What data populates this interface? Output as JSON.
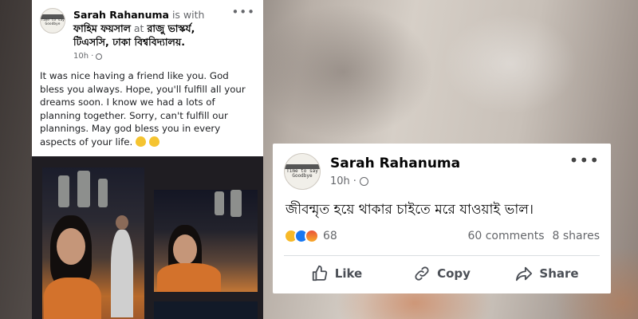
{
  "left_post": {
    "author": "Sarah Rahanuma",
    "with_text": "is with",
    "tagged": "ফাহিম ফয়সাল",
    "at_text": "at",
    "location": "রাজু ভাস্কর্য, টিএসসি, ঢাকা বিশ্ববিদ্যালয়.",
    "time": "10h",
    "body": "It was nice having a friend like you. God bless you always. Hope, you'll fulfill all your dreams soon. I know we had a lots of planning together. Sorry, can't fulfill our plannings. May god bless you in every aspects of your life.",
    "avatar_text": "Time to say Goodbye"
  },
  "right_post": {
    "author": "Sarah Rahanuma",
    "time": "10h",
    "body": "জীবন্মৃত হয়ে থাকার চাইতে মরে যাওয়াই ভাল।",
    "reaction_count": "68",
    "comments": "60 comments",
    "shares": "8 shares",
    "actions": {
      "like": "Like",
      "copy": "Copy",
      "share": "Share"
    },
    "avatar_text": "Time to say Goodbye"
  },
  "icons": [
    "globe-icon",
    "more-icon",
    "heart-emoji-icon",
    "like-icon",
    "copy-icon",
    "share-icon",
    "sad-reaction-icon",
    "like-reaction-icon",
    "angry-reaction-icon"
  ]
}
